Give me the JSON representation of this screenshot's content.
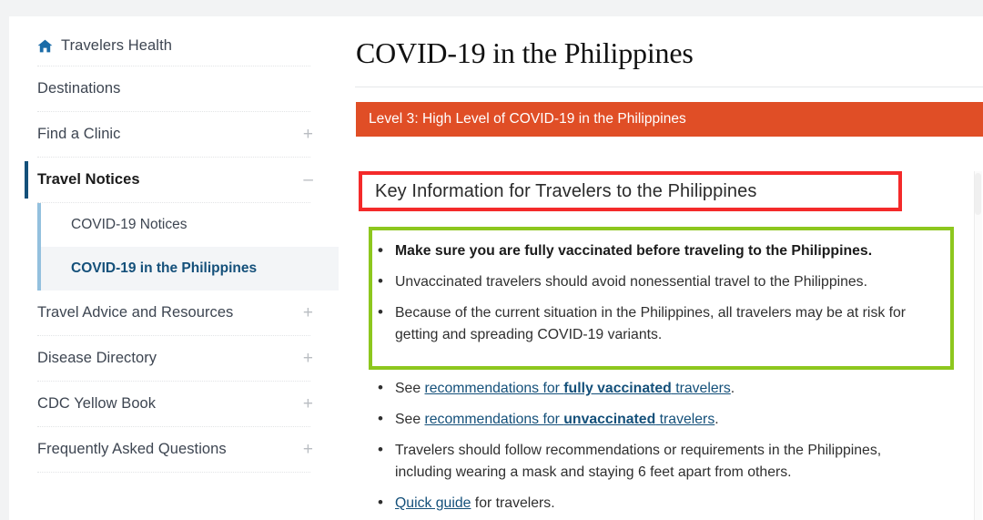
{
  "sidebar": {
    "home": {
      "label": "Travelers Health",
      "icon": "home-icon"
    },
    "items": [
      {
        "label": "Destinations",
        "toggle": ""
      },
      {
        "label": "Find a Clinic",
        "toggle": "+"
      },
      {
        "label": "Travel Notices",
        "toggle": "–"
      }
    ],
    "subitems": [
      {
        "label": "COVID-19 Notices",
        "active": false
      },
      {
        "label": "COVID-19 in the Philippines",
        "active": true
      }
    ],
    "items_after": [
      {
        "label": "Travel Advice and Resources",
        "toggle": "+"
      },
      {
        "label": "Disease Directory",
        "toggle": "+"
      },
      {
        "label": "CDC Yellow Book",
        "toggle": "+"
      },
      {
        "label": "Frequently Asked Questions",
        "toggle": "+"
      }
    ]
  },
  "main": {
    "title": "COVID-19 in the Philippines",
    "alert": {
      "text": "Level 3: High Level of COVID-19 in the Philippines",
      "color": "#e04e26"
    },
    "key_info_heading": "Key Information for Travelers to the Philippines",
    "highlighted_bullets": [
      "Make sure you are fully vaccinated before traveling to the Philippines.",
      "Unvaccinated travelers should avoid nonessential travel to the Philippines.",
      "Because of the current situation in the Philippines, all travelers may be at risk for getting and spreading COVID-19 variants."
    ],
    "link_bullets": [
      {
        "prefix": "See ",
        "link_before": "recommendations for ",
        "link_bold": "fully vaccinated",
        "link_after": " travelers",
        "suffix": "."
      },
      {
        "prefix": "See ",
        "link_before": "recommendations for ",
        "link_bold": "unvaccinated",
        "link_after": " travelers",
        "suffix": "."
      }
    ],
    "plain_bullet": "Travelers should follow recommendations or requirements in the Philippines, including wearing a mask and staying 6 feet apart from others.",
    "quick_guide": {
      "link": "Quick guide",
      "rest": " for travelers."
    }
  },
  "annotations": {
    "key_info_box_color": "#f42a2a",
    "bullets_box_color": "#8dc71e"
  }
}
